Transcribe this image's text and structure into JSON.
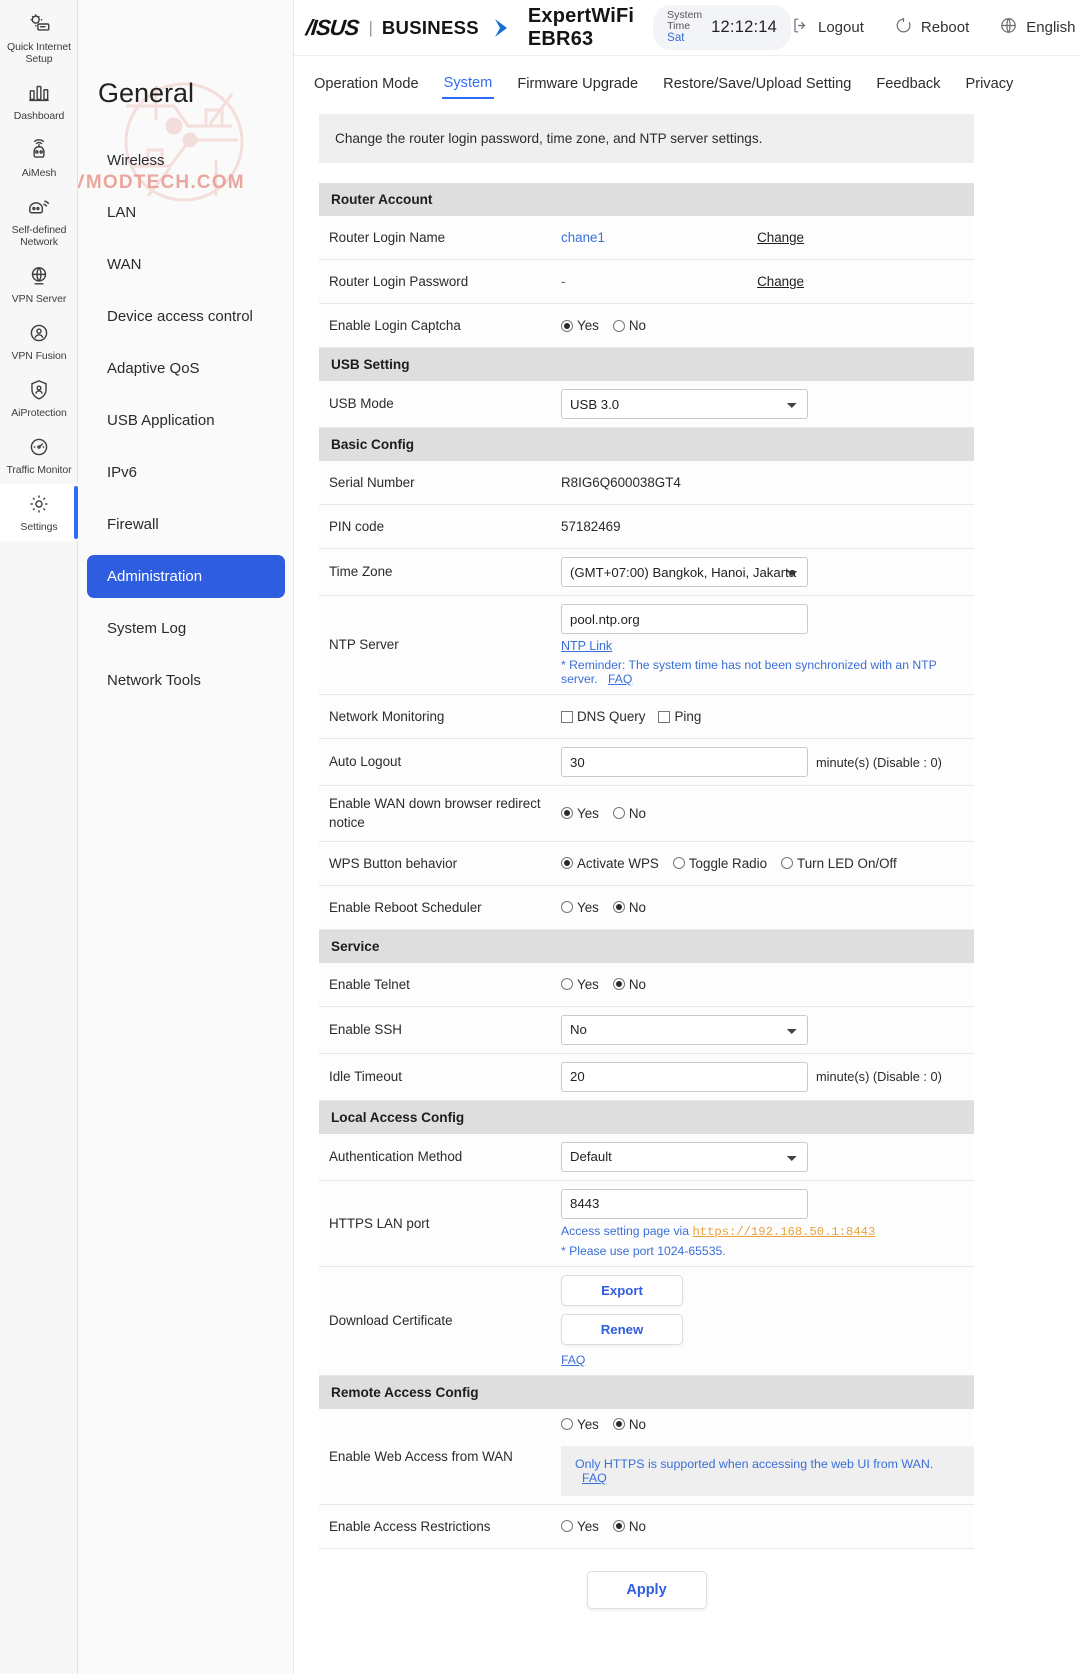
{
  "header": {
    "asus_logo": "/ISUS",
    "separator": "|",
    "business": "BUSINESS",
    "model": "ExpertWiFi EBR63",
    "system_time_label": "System Time",
    "system_time_day": "Sat",
    "system_time_clock": "12:12:14",
    "logout": "Logout",
    "reboot": "Reboot",
    "language": "English",
    "language_caret": "▾"
  },
  "rail": {
    "items": [
      {
        "label": "Quick Internet Setup",
        "icon": "quick-setup-icon",
        "active": false
      },
      {
        "label": "Dashboard",
        "icon": "dashboard-icon",
        "active": false
      },
      {
        "label": "AiMesh",
        "icon": "aimesh-icon",
        "active": false
      },
      {
        "label": "Self-defined Network",
        "icon": "self-defined-network-icon",
        "active": false
      },
      {
        "label": "VPN Server",
        "icon": "vpn-server-icon",
        "active": false
      },
      {
        "label": "VPN Fusion",
        "icon": "vpn-fusion-icon",
        "active": false
      },
      {
        "label": "AiProtection",
        "icon": "aiprotection-icon",
        "active": false
      },
      {
        "label": "Traffic Monitor",
        "icon": "traffic-monitor-icon",
        "active": false
      },
      {
        "label": "Settings",
        "icon": "settings-gear-icon",
        "active": true
      }
    ]
  },
  "subnav": {
    "title": "General",
    "watermark": "VMODTECH.COM",
    "items": [
      {
        "label": "Wireless",
        "active": false
      },
      {
        "label": "LAN",
        "active": false
      },
      {
        "label": "WAN",
        "active": false
      },
      {
        "label": "Device access control",
        "active": false
      },
      {
        "label": "Adaptive QoS",
        "active": false
      },
      {
        "label": "USB Application",
        "active": false
      },
      {
        "label": "IPv6",
        "active": false
      },
      {
        "label": "Firewall",
        "active": false
      },
      {
        "label": "Administration",
        "active": true
      },
      {
        "label": "System Log",
        "active": false
      },
      {
        "label": "Network Tools",
        "active": false
      }
    ]
  },
  "tabs": [
    {
      "label": "Operation Mode",
      "active": false
    },
    {
      "label": "System",
      "active": true
    },
    {
      "label": "Firmware Upgrade",
      "active": false
    },
    {
      "label": "Restore/Save/Upload Setting",
      "active": false
    },
    {
      "label": "Feedback",
      "active": false
    },
    {
      "label": "Privacy",
      "active": false
    }
  ],
  "page": {
    "description": "Change the router login password, time zone, and NTP server settings."
  },
  "router_account": {
    "section_title": "Router Account",
    "login_name_label": "Router Login Name",
    "login_name_value": "chane1",
    "login_name_change": "Change",
    "login_password_label": "Router Login Password",
    "login_password_value": "-",
    "login_password_change": "Change",
    "captcha_label": "Enable Login Captcha",
    "captcha_yes": "Yes",
    "captcha_no": "No",
    "captcha_selected": "Yes"
  },
  "usb_setting": {
    "section_title": "USB Setting",
    "usb_mode_label": "USB Mode",
    "usb_mode_value": "USB 3.0"
  },
  "basic_config": {
    "section_title": "Basic Config",
    "serial_label": "Serial Number",
    "serial_value": "R8IG6Q600038GT4",
    "pin_label": "PIN code",
    "pin_value": "57182469",
    "timezone_label": "Time Zone",
    "timezone_value": "(GMT+07:00) Bangkok, Hanoi, Jakarta",
    "ntp_label": "NTP Server",
    "ntp_value": "pool.ntp.org",
    "ntp_link": "NTP Link",
    "ntp_reminder": "* Reminder: The system time has not been synchronized with an NTP server.",
    "ntp_faq": "FAQ",
    "netmon_label": "Network Monitoring",
    "netmon_dns": "DNS Query",
    "netmon_ping": "Ping",
    "autologout_label": "Auto Logout",
    "autologout_value": "30",
    "autologout_suffix": "minute(s) (Disable : 0)",
    "wandown_label": "Enable WAN down browser redirect notice",
    "wandown_yes": "Yes",
    "wandown_no": "No",
    "wandown_selected": "Yes",
    "wps_label": "WPS Button behavior",
    "wps_opt1": "Activate WPS",
    "wps_opt2": "Toggle Radio",
    "wps_opt3": "Turn LED On/Off",
    "wps_selected": "Activate WPS",
    "reboot_sched_label": "Enable Reboot Scheduler",
    "reboot_sched_yes": "Yes",
    "reboot_sched_no": "No",
    "reboot_sched_selected": "No"
  },
  "service": {
    "section_title": "Service",
    "telnet_label": "Enable Telnet",
    "telnet_yes": "Yes",
    "telnet_no": "No",
    "telnet_selected": "No",
    "ssh_label": "Enable SSH",
    "ssh_value": "No",
    "idle_label": "Idle Timeout",
    "idle_value": "20",
    "idle_suffix": "minute(s) (Disable : 0)"
  },
  "local_access": {
    "section_title": "Local Access Config",
    "auth_label": "Authentication Method",
    "auth_value": "Default",
    "https_label": "HTTPS LAN port",
    "https_value": "8443",
    "https_hint_prefix": "Access setting page via",
    "https_url": "https://192.168.50.1:8443",
    "https_note": "* Please use port 1024-65535.",
    "cert_label": "Download Certificate",
    "cert_export": "Export",
    "cert_renew": "Renew",
    "cert_faq": "FAQ"
  },
  "remote_access": {
    "section_title": "Remote Access Config",
    "wan_label": "Enable Web Access from WAN",
    "wan_yes": "Yes",
    "wan_no": "No",
    "wan_selected": "No",
    "wan_info": "Only HTTPS is supported when accessing the web UI from WAN.",
    "wan_info_faq": "FAQ",
    "restrict_label": "Enable Access Restrictions",
    "restrict_yes": "Yes",
    "restrict_no": "No",
    "restrict_selected": "No"
  },
  "footer": {
    "apply": "Apply"
  },
  "colors": {
    "accent": "#2f6df6",
    "nav_active": "#2f5de0",
    "link": "#3a6fd8",
    "url": "#e8a33d"
  }
}
